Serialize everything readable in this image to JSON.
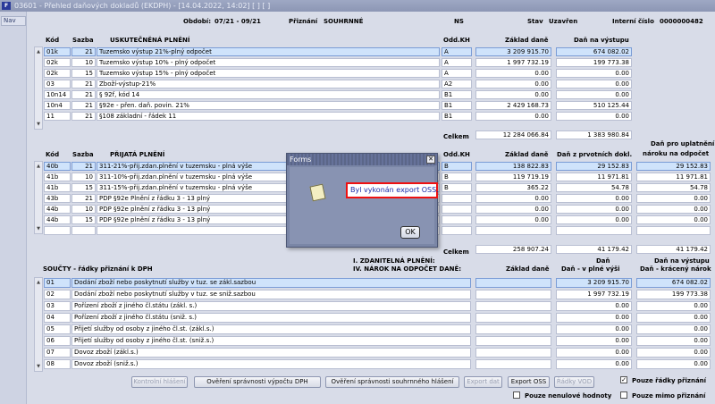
{
  "window": {
    "title": "03601 - Přehled daňových dokladů (EKDPH) - [14.04.2022, 14:02] [ ] [ ]"
  },
  "nav": {
    "label": "Nav"
  },
  "header": {
    "obdobi_label": "Období:",
    "obdobi_value": "07/21 - 09/21",
    "priznani_label": "Přiznání",
    "priznani_value": "SOUHRNNÉ",
    "ns_label": "NS",
    "stav_label": "Stav",
    "stav_value": "Uzavřen",
    "interni_label": "Interní číslo",
    "interni_value": "0000000482"
  },
  "sec1": {
    "h_kod": "Kód",
    "h_sazba": "Sazba",
    "h_title": "USKUTEČNĚNÁ PLNĚNÍ",
    "h_odd": "Odd.KH",
    "h_zaklad": "Základ daně",
    "h_dan": "Daň na výstupu",
    "rows": [
      {
        "kod": "01k",
        "sazba": "21",
        "nazev": "Tuzemsko výstup 21%-plný odpočet",
        "odd": "A",
        "zaklad": "3 209 915.70",
        "dan": "674 082.02"
      },
      {
        "kod": "02k",
        "sazba": "10",
        "nazev": "Tuzemsko výstup 10% - plný odpočet",
        "odd": "A",
        "zaklad": "1 997 732.19",
        "dan": "199 773.38"
      },
      {
        "kod": "02k",
        "sazba": "15",
        "nazev": "Tuzemsko výstup 15% - plný odpočet",
        "odd": "A",
        "zaklad": "0.00",
        "dan": "0.00"
      },
      {
        "kod": "03",
        "sazba": "21",
        "nazev": "Zboží-výstup-21%",
        "odd": "A2",
        "zaklad": "0.00",
        "dan": "0.00"
      },
      {
        "kod": "10n14",
        "sazba": "21",
        "nazev": "§ 92f, kód 14",
        "odd": "B1",
        "zaklad": "0.00",
        "dan": "0.00"
      },
      {
        "kod": "10n4",
        "sazba": "21",
        "nazev": "§92e - přen. daň. povin. 21%",
        "odd": "B1",
        "zaklad": "2 429 168.73",
        "dan": "510 125.44"
      },
      {
        "kod": "11",
        "sazba": "21",
        "nazev": "§108 základní - řádek 11",
        "odd": "B1",
        "zaklad": "0.00",
        "dan": "0.00"
      }
    ],
    "celkem_label": "Celkem",
    "celkem_zaklad": "12 284 066.84",
    "celkem_dan": "1 383 980.84"
  },
  "sec2": {
    "h_kod": "Kód",
    "h_sazba": "Sazba",
    "h_title": "PŘIJATÁ PLNĚNÍ",
    "h_odd": "Odd.KH",
    "h_zaklad": "Základ daně",
    "h_dan": "Daň z prvotních dokl.",
    "h_nar1": "Daň pro uplatnění",
    "h_nar2": "nároku na odpočet",
    "rows": [
      {
        "kod": "40b",
        "sazba": "21",
        "nazev": "311-21%-přij.zdan.plnění v tuzemsku - plná výše",
        "odd": "B",
        "zaklad": "138 822.83",
        "dan": "29 152.83",
        "narok": "29 152.83"
      },
      {
        "kod": "41b",
        "sazba": "10",
        "nazev": "311-10%-přij.zdan.plnění v tuzemsku - plná výše",
        "odd": "B",
        "zaklad": "119 719.19",
        "dan": "11 971.81",
        "narok": "11 971.81"
      },
      {
        "kod": "41b",
        "sazba": "15",
        "nazev": "311-15%-přij.zdan.plnění v tuzemsku - plná výše",
        "odd": "B",
        "zaklad": "365.22",
        "dan": "54.78",
        "narok": "54.78"
      },
      {
        "kod": "43b",
        "sazba": "21",
        "nazev": "PDP §92e Plnění z řádku 3 - 13 plný",
        "odd": "",
        "zaklad": "0.00",
        "dan": "0.00",
        "narok": "0.00"
      },
      {
        "kod": "44b",
        "sazba": "10",
        "nazev": "PDP §92e plnění z řádku 3 - 13 plný",
        "odd": "",
        "zaklad": "0.00",
        "dan": "0.00",
        "narok": "0.00"
      },
      {
        "kod": "44b",
        "sazba": "15",
        "nazev": "PDP §92e plnění z řádku 3 - 13 plný",
        "odd": "",
        "zaklad": "0.00",
        "dan": "0.00",
        "narok": "0.00"
      }
    ],
    "celkem_label": "Celkem",
    "celkem_zaklad": "258 907.24",
    "celkem_dan": "41 179.42",
    "celkem_narok": "41 179.42"
  },
  "sec3": {
    "h_title": "SOUČTY - řádky přiznání k DPH",
    "h_mid1": "I. ZDANITELNÁ PLNĚNÍ:",
    "h_mid2": "IV. NÁROK NA ODPOČET DANĚ:",
    "h_zaklad": "Základ daně",
    "h_dan1": "Daň",
    "h_dan2": "Daň - v plné výši",
    "h_nar1": "Daň na výstupu",
    "h_nar2": "Daň - krácený nárok",
    "rows": [
      {
        "kod": "01",
        "nazev": "Dodání zboží nebo poskytnutí služby v tuz. se zákl.sazbou",
        "zaklad": "",
        "dan": "3 209 915.70",
        "narok": "674 082.02"
      },
      {
        "kod": "02",
        "nazev": "Dodání zboží nebo poskytnutí služby v tuz. se sniž.sazbou",
        "zaklad": "",
        "dan": "1 997 732.19",
        "narok": "199 773.38"
      },
      {
        "kod": "03",
        "nazev": "Pořízení zboží z jiného čl.státu (zákl. s.)",
        "zaklad": "",
        "dan": "0.00",
        "narok": "0.00"
      },
      {
        "kod": "04",
        "nazev": "Pořízení zboží z jiného čl.státu (sniž. s.)",
        "zaklad": "",
        "dan": "0.00",
        "narok": "0.00"
      },
      {
        "kod": "05",
        "nazev": "Přijetí služby od osoby z jiného čl.st. (zákl.s.)",
        "zaklad": "",
        "dan": "0.00",
        "narok": "0.00"
      },
      {
        "kod": "06",
        "nazev": "Přijetí služby od osoby z jiného čl.st. (sniž.s.)",
        "zaklad": "",
        "dan": "0.00",
        "narok": "0.00"
      },
      {
        "kod": "07",
        "nazev": "Dovoz zboží (zákl.s.)",
        "zaklad": "",
        "dan": "0.00",
        "narok": "0.00"
      },
      {
        "kod": "08",
        "nazev": "Dovoz zboží (sniž.s.)",
        "zaklad": "",
        "dan": "0.00",
        "narok": "0.00"
      }
    ]
  },
  "buttons": {
    "kontrolni": "Kontrolní hlášení",
    "overeni_vypoctu": "Ověření správnosti výpočtu DPH",
    "overeni_souhrnneho": "Ověření správnosti souhrnného hlášení",
    "export_dat": "Export dat",
    "export_oss": "Export OSS",
    "radky_vod": "Řádky VOD"
  },
  "checks": {
    "pouze_radky": "Pouze řádky přiznání",
    "pouze_nenulove": "Pouze nenulové hodnoty",
    "pouze_mimo": "Pouze mimo přiznání"
  },
  "dialog": {
    "title": "Forms",
    "message": "Byl vykonán export OSS.",
    "ok": "OK",
    "close": "✕"
  }
}
